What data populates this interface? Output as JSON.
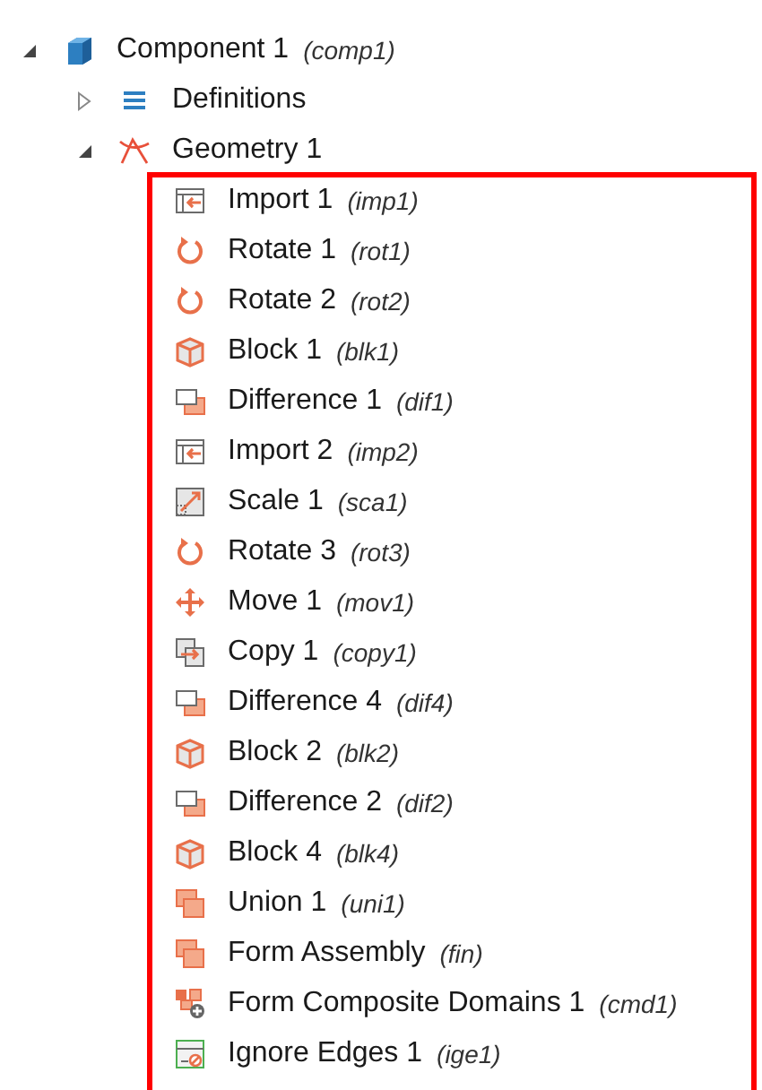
{
  "tree": [
    {
      "label": "Component 1",
      "tag": "(comp1)",
      "kind": "component",
      "expanded": true,
      "children": [
        {
          "label": "Definitions",
          "kind": "definitions",
          "expanded": false
        },
        {
          "label": "Geometry 1",
          "kind": "geometry",
          "expanded": true,
          "children": [
            {
              "label": "Import 1",
              "tag": "(imp1)",
              "kind": "import"
            },
            {
              "label": "Rotate 1",
              "tag": "(rot1)",
              "kind": "rotate"
            },
            {
              "label": "Rotate 2",
              "tag": "(rot2)",
              "kind": "rotate"
            },
            {
              "label": "Block 1",
              "tag": "(blk1)",
              "kind": "block"
            },
            {
              "label": "Difference 1",
              "tag": "(dif1)",
              "kind": "difference"
            },
            {
              "label": "Import 2",
              "tag": "(imp2)",
              "kind": "import"
            },
            {
              "label": "Scale 1",
              "tag": "(sca1)",
              "kind": "scale"
            },
            {
              "label": "Rotate 3",
              "tag": "(rot3)",
              "kind": "rotate"
            },
            {
              "label": "Move 1",
              "tag": "(mov1)",
              "kind": "move"
            },
            {
              "label": "Copy 1",
              "tag": "(copy1)",
              "kind": "copy"
            },
            {
              "label": "Difference 4",
              "tag": "(dif4)",
              "kind": "difference"
            },
            {
              "label": "Block 2",
              "tag": "(blk2)",
              "kind": "block"
            },
            {
              "label": "Difference 2",
              "tag": "(dif2)",
              "kind": "difference"
            },
            {
              "label": "Block 4",
              "tag": "(blk4)",
              "kind": "block"
            },
            {
              "label": "Union 1",
              "tag": "(uni1)",
              "kind": "union"
            },
            {
              "label": "Form Assembly",
              "tag": "(fin)",
              "kind": "union"
            },
            {
              "label": "Form Composite Domains 1",
              "tag": "(cmd1)",
              "kind": "composite"
            },
            {
              "label": "Ignore Edges 1",
              "tag": "(ige1)",
              "kind": "ignore"
            }
          ]
        }
      ]
    }
  ]
}
